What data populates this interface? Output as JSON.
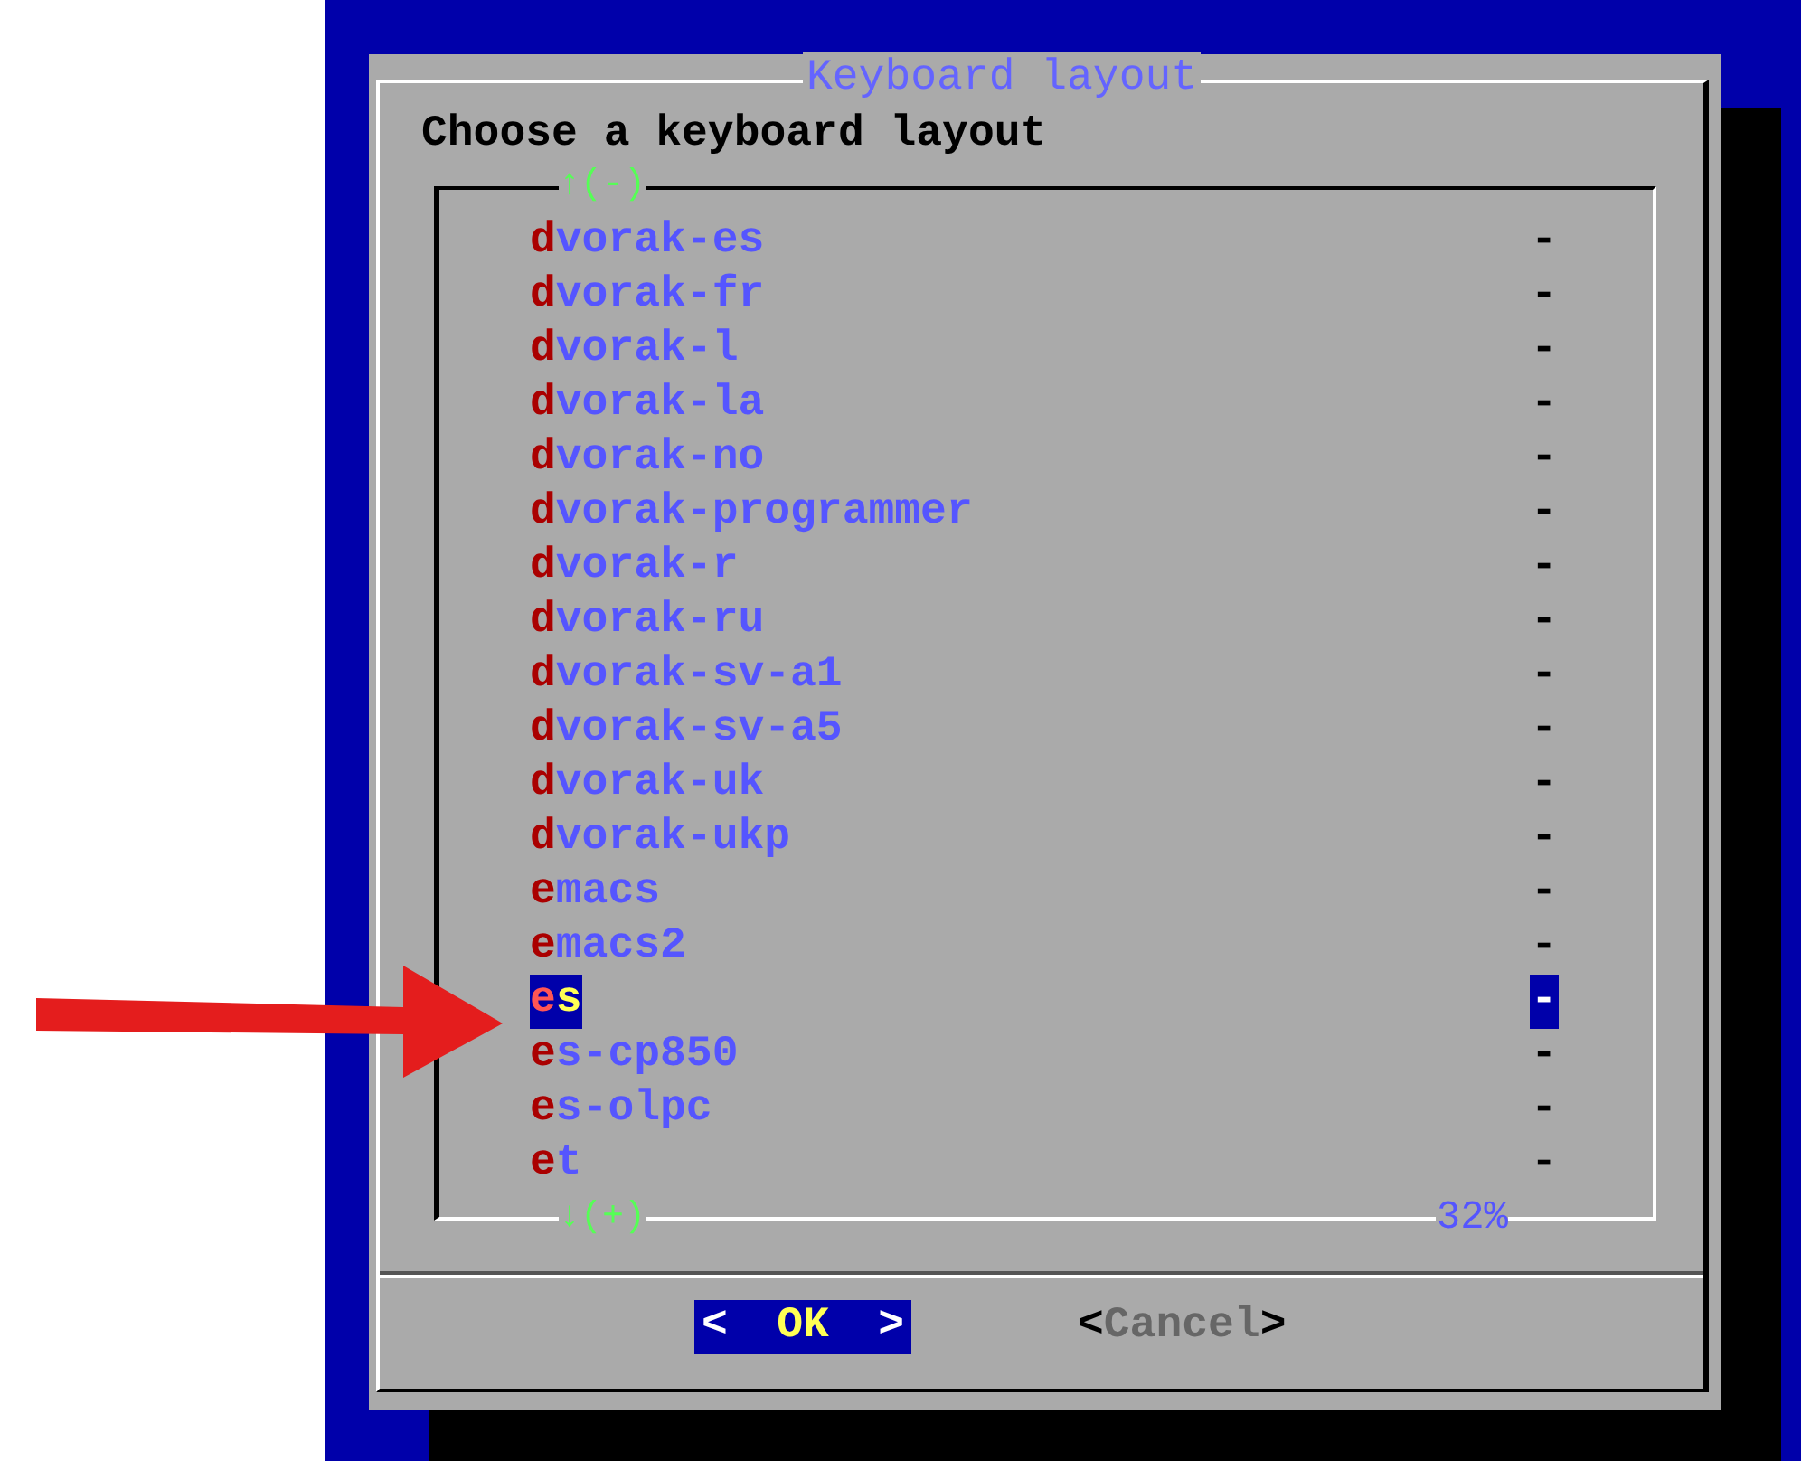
{
  "dialog": {
    "title": "Keyboard layout",
    "prompt": "Choose a keyboard layout"
  },
  "list": {
    "scroll_up": "↑(-)",
    "scroll_down": "↓(+)",
    "percent": "32%",
    "items": [
      {
        "name": "dvorak-es",
        "description": "-",
        "selected": false
      },
      {
        "name": "dvorak-fr",
        "description": "-",
        "selected": false
      },
      {
        "name": "dvorak-l",
        "description": "-",
        "selected": false
      },
      {
        "name": "dvorak-la",
        "description": "-",
        "selected": false
      },
      {
        "name": "dvorak-no",
        "description": "-",
        "selected": false
      },
      {
        "name": "dvorak-programmer",
        "description": "-",
        "selected": false
      },
      {
        "name": "dvorak-r",
        "description": "-",
        "selected": false
      },
      {
        "name": "dvorak-ru",
        "description": "-",
        "selected": false
      },
      {
        "name": "dvorak-sv-a1",
        "description": "-",
        "selected": false
      },
      {
        "name": "dvorak-sv-a5",
        "description": "-",
        "selected": false
      },
      {
        "name": "dvorak-uk",
        "description": "-",
        "selected": false
      },
      {
        "name": "dvorak-ukp",
        "description": "-",
        "selected": false
      },
      {
        "name": "emacs",
        "description": "-",
        "selected": false
      },
      {
        "name": "emacs2",
        "description": "-",
        "selected": false
      },
      {
        "name": "es",
        "description": "-",
        "selected": true
      },
      {
        "name": "es-cp850",
        "description": "-",
        "selected": false
      },
      {
        "name": "es-olpc",
        "description": "-",
        "selected": false
      },
      {
        "name": "et",
        "description": "-",
        "selected": false
      }
    ]
  },
  "buttons": [
    {
      "label": "OK",
      "open": "<",
      "close": ">",
      "selected": true
    },
    {
      "label": "Cancel",
      "open": "<",
      "close": ">",
      "selected": false
    }
  ]
}
